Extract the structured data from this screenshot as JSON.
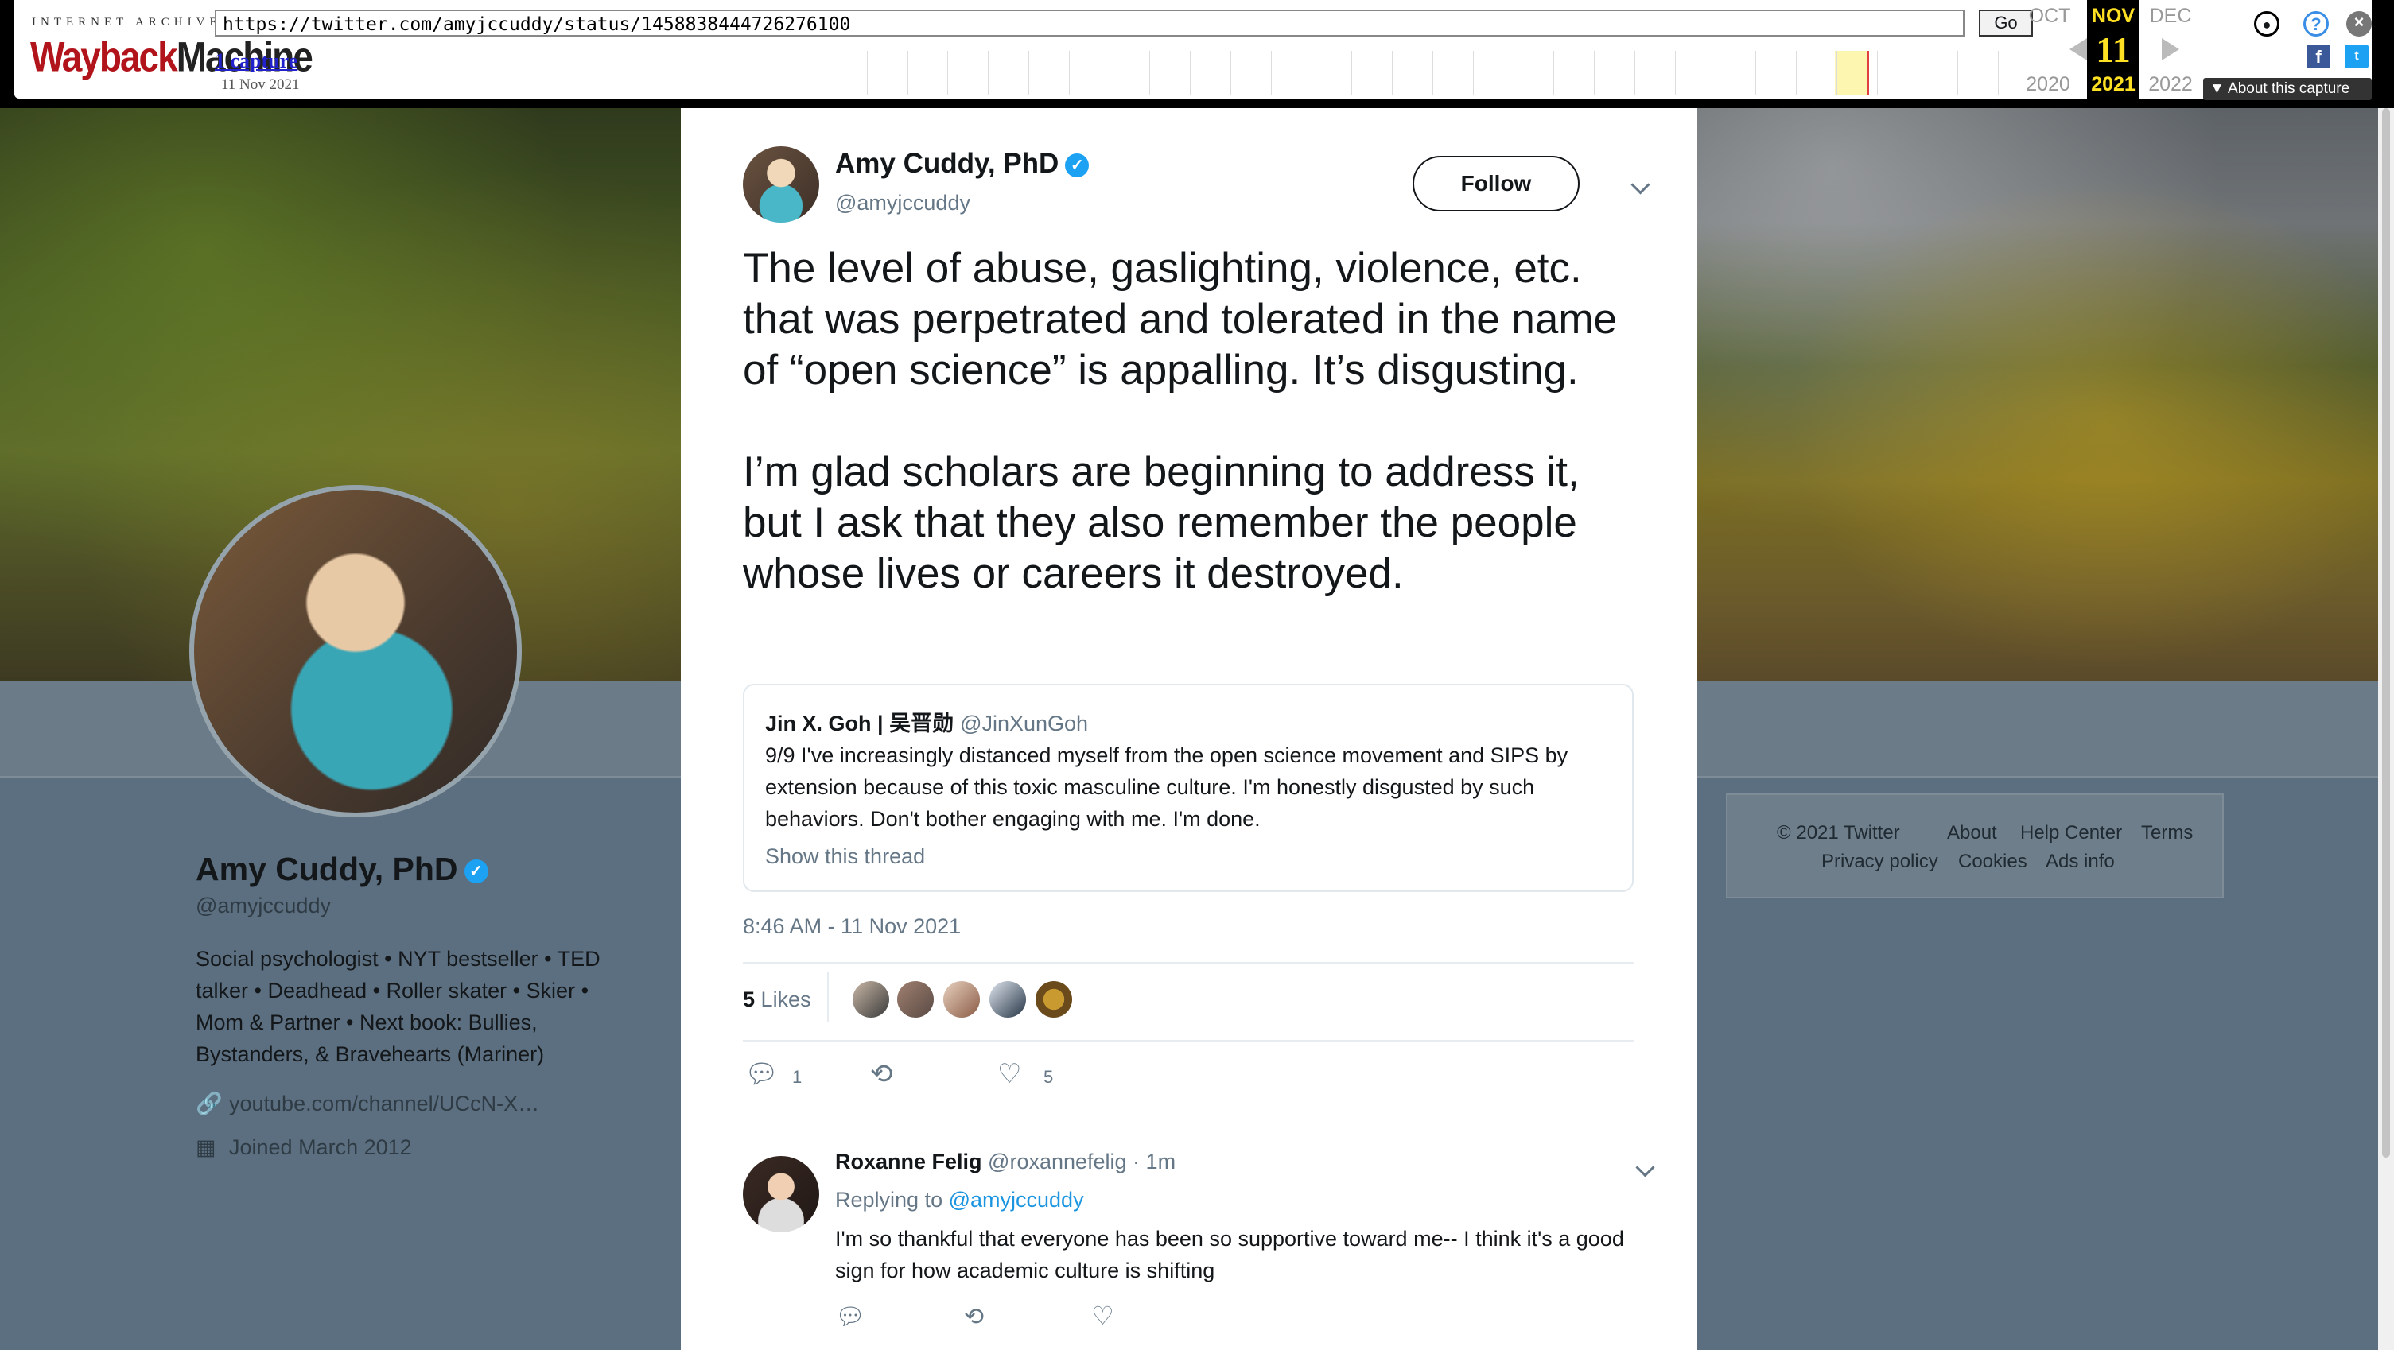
{
  "wayback": {
    "logo_top": "INTERNET ARCHIVE",
    "logo_main_a": "Wayback",
    "logo_main_b": "Machine",
    "url": "https://twitter.com/amyjccuddy/status/1458838444726276100",
    "go_label": "Go",
    "captures_label": "1 capture",
    "capture_date": "11 Nov 2021",
    "prev_month": "OCT",
    "cur_month": "NOV",
    "next_month": "DEC",
    "cur_day": "11",
    "prev_year": "2020",
    "cur_year": "2021",
    "next_year": "2022",
    "about_label": "About this capture",
    "accent": "#ffe022"
  },
  "profile": {
    "name": "Amy Cuddy, PhD",
    "handle": "@amyjccuddy",
    "bio": "Social psychologist • NYT bestseller • TED talker • Deadhead • Roller skater • Skier • Mom & Partner • Next book: Bullies, Bystanders, & Bravehearts (Mariner)",
    "link": "youtube.com/channel/UCcN-X…",
    "joined": "Joined March 2012"
  },
  "tweet": {
    "author_name": "Amy Cuddy, PhD",
    "author_handle": "@amyjccuddy",
    "follow_label": "Follow",
    "text": "The level of abuse, gaslighting, violence, etc. that was perpetrated and tolerated in the name of “open science” is appalling. It’s disgusting.\n\nI’m glad scholars are beginning to address it, but I ask that they also remember the people whose lives or careers it destroyed.",
    "quote": {
      "name": "Jin X. Goh | 吴晋勋",
      "handle": "@JinXunGoh",
      "text": "9/9 I've increasingly distanced myself from the open science movement and SIPS by extension because of this toxic masculine culture. I'm honestly disgusted by such behaviors. Don't bother engaging with me. I'm done.",
      "show_thread": "Show this thread"
    },
    "timestamp": "8:46 AM - 11 Nov 2021",
    "likes_count": "5",
    "likes_label": "Likes",
    "reply_count": "1",
    "like_count_action": "5"
  },
  "reply": {
    "name": "Roxanne Felig",
    "handle_time": "@roxannefelig · 1m",
    "replying_prefix": "Replying to",
    "replying_to": "@amyjccuddy",
    "text": "I'm so thankful that everyone has been so supportive toward me-- I think it's a good sign for how academic culture is shifting"
  },
  "footer": {
    "copyright": "© 2021 Twitter",
    "about": "About",
    "help": "Help Center",
    "terms": "Terms",
    "privacy": "Privacy policy",
    "cookies": "Cookies",
    "ads": "Ads info"
  },
  "icons": {
    "verified": "verified-check-icon",
    "link": "link-icon",
    "calendar": "calendar-icon",
    "reply": "reply-icon",
    "retweet": "retweet-icon",
    "like": "heart-icon"
  },
  "colors": {
    "link_blue": "#1b95e0",
    "verified_blue": "#1da1f2",
    "muted": "#657786"
  }
}
